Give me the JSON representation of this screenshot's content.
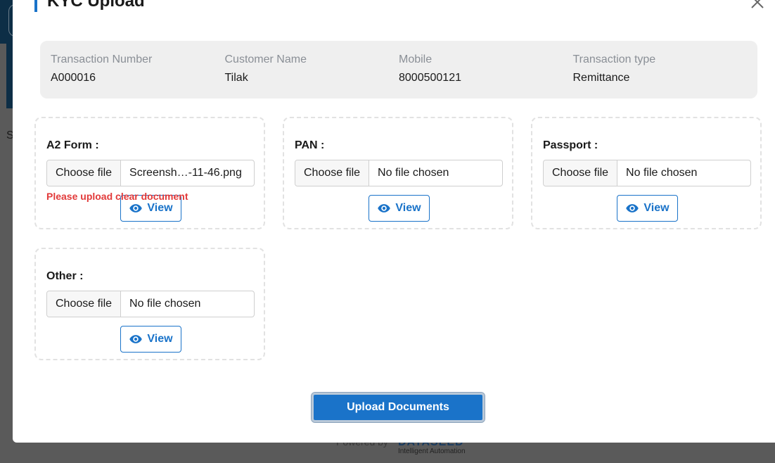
{
  "background": {
    "partial_text": "S",
    "footer_powered": "Powered by",
    "footer_logo": "DATASEED",
    "footer_tagline": "Intelligent Automation"
  },
  "modal": {
    "title": "KYC Upload",
    "close_icon": "close-icon"
  },
  "transaction": {
    "number_label": "Transaction Number",
    "number_value": "A000016",
    "customer_label": "Customer Name",
    "customer_value": "Tilak",
    "mobile_label": "Mobile",
    "mobile_value": "8000500121",
    "type_label": "Transaction type",
    "type_value": "Remittance"
  },
  "documents": [
    {
      "label": "A2 Form :",
      "choose_label": "Choose file",
      "file_name": "Screensh…-11-46.png",
      "error": "Please upload clear document",
      "view_label": "View"
    },
    {
      "label": "PAN :",
      "choose_label": "Choose file",
      "file_name": "No file chosen",
      "view_label": "View"
    },
    {
      "label": "Passport :",
      "choose_label": "Choose file",
      "file_name": "No file chosen",
      "view_label": "View"
    },
    {
      "label": "Other :",
      "choose_label": "Choose file",
      "file_name": "No file chosen",
      "view_label": "View"
    }
  ],
  "actions": {
    "upload_label": "Upload Documents"
  },
  "colors": {
    "accent": "#1a73c9",
    "error": "#e23a3a",
    "info_bg": "#efefef"
  }
}
